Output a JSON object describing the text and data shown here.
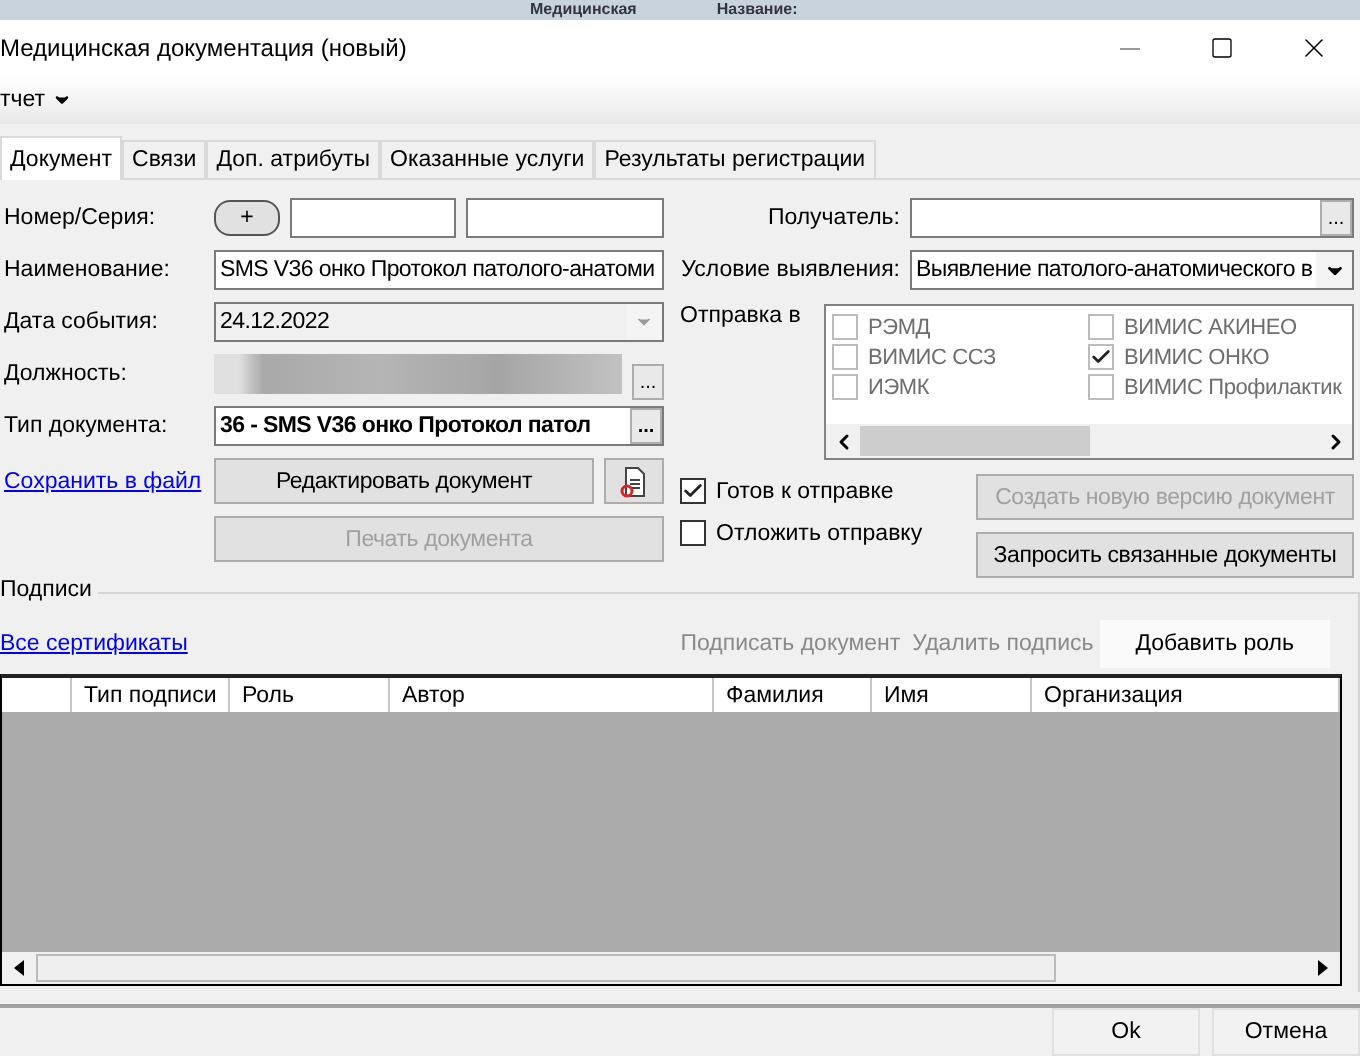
{
  "background_strip": {
    "texts": [
      "Медицинская",
      "Название:"
    ]
  },
  "window": {
    "title": "Медицинская документация (новый)"
  },
  "menu": {
    "label": "тчет"
  },
  "tabs": [
    {
      "label": "Документ",
      "selected": true
    },
    {
      "label": "Связи",
      "selected": false
    },
    {
      "label": "Доп. атрибуты",
      "selected": false
    },
    {
      "label": "Оказанные услуги",
      "selected": false
    },
    {
      "label": "Результаты регистрации",
      "selected": false
    }
  ],
  "left_fields": [
    {
      "kind": "number",
      "label": "Номер/Серия:",
      "button": "+"
    },
    {
      "kind": "text",
      "label": "Наименование:",
      "value": "SMS V36 онко Протокол патолого-анатоми"
    },
    {
      "kind": "date",
      "label": "Дата события:",
      "value": "24.12.2022"
    },
    {
      "kind": "redacted",
      "label": "Должность:",
      "button": "..."
    },
    {
      "kind": "lookup",
      "label": "Тип документа:",
      "value": "36 - SMS V36 онко Протокол патол",
      "button": "..."
    }
  ],
  "save_link": "Сохранить в файл",
  "edit_button": {
    "label": "Редактировать документ",
    "disabled": false
  },
  "print_button": {
    "label": "Печать документа",
    "disabled": true
  },
  "recipient": {
    "label": "Получатель:",
    "button": "..."
  },
  "condition": {
    "label": "Условие выявления:",
    "value": "Выявление патолого-анатомического в"
  },
  "send_to": {
    "label": "Отправка в",
    "disabled": true,
    "options": [
      {
        "label": "РЭМД",
        "checked": false
      },
      {
        "label": "ВИМИС АКИНЕО",
        "checked": false
      },
      {
        "label": "ВИМИС ССЗ",
        "checked": false
      },
      {
        "label": "ВИМИС ОНКО",
        "checked": true
      },
      {
        "label": "ИЭМК",
        "checked": false
      },
      {
        "label": "ВИМИС Профилактик",
        "checked": false
      }
    ]
  },
  "ready": {
    "label": "Готов к отправке",
    "checked": true
  },
  "postpone": {
    "label": "Отложить отправку",
    "checked": false
  },
  "new_version_button": {
    "label": "Создать новую версию документ",
    "disabled": true
  },
  "request_button": {
    "label": "Запросить связанные документы",
    "disabled": false
  },
  "signatures": {
    "title": "Подписи",
    "link": "Все сертификаты",
    "actions": [
      {
        "label": "Подписать документ",
        "disabled": true
      },
      {
        "label": "Удалить подпись",
        "disabled": true
      },
      {
        "label": "Добавить роль",
        "disabled": false
      }
    ],
    "columns": [
      "Тип подписи",
      "Роль",
      "Автор",
      "Фамилия",
      "Имя",
      "Организация"
    ]
  },
  "footer": {
    "buttons": [
      "Ok",
      "Отмена"
    ]
  }
}
